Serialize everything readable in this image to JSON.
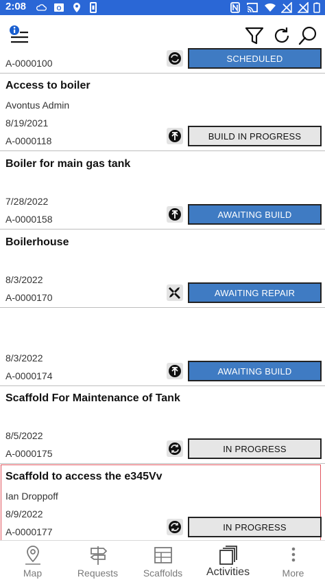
{
  "status_bar": {
    "time": "2:08",
    "icons": [
      "cloud-icon",
      "outlook-icon",
      "location-icon",
      "battery-saver-icon",
      "nfc-icon",
      "cast-icon",
      "wifi-icon",
      "no-signal-icon",
      "battery-icon"
    ]
  },
  "app_bar": {
    "icons": [
      "info-menu-icon",
      "filter-icon",
      "refresh-icon",
      "search-icon"
    ]
  },
  "partial_item": {
    "ref": "A-0000100",
    "status": "SCHEDULED"
  },
  "items": [
    {
      "title": "Access to boiler",
      "subtitle": "Avontus Admin",
      "date": "8/19/2021",
      "ref": "A-0000118",
      "status": "BUILD IN PROGRESS",
      "status_icon": "build-arrow-icon",
      "status_style": "gray"
    },
    {
      "title": "Boiler for main gas tank",
      "subtitle": "",
      "date": "7/28/2022",
      "ref": "A-0000158",
      "status": "AWAITING BUILD",
      "status_icon": "build-arrow-icon",
      "status_style": "blue"
    },
    {
      "title": "Boilerhouse",
      "subtitle": "",
      "date": "8/3/2022",
      "ref": "A-0000170",
      "status": "AWAITING REPAIR",
      "status_icon": "repair-tools-icon",
      "status_style": "blue"
    },
    {
      "title": "",
      "subtitle": "",
      "date": "8/3/2022",
      "ref": "A-0000174",
      "status": "AWAITING BUILD",
      "status_icon": "build-arrow-icon",
      "status_style": "blue"
    },
    {
      "title": "Scaffold For Maintenance of Tank",
      "subtitle": "",
      "date": "8/5/2022",
      "ref": "A-0000175",
      "status": "IN PROGRESS",
      "status_icon": "in-progress-cycle-icon",
      "status_style": "gray"
    },
    {
      "title": "Scaffold to access the e345Vv",
      "subtitle": "Ian Droppoff",
      "date": "8/9/2022",
      "ref": "A-0000177",
      "status": "IN PROGRESS",
      "status_icon": "in-progress-cycle-icon",
      "status_style": "gray",
      "selected": true
    }
  ],
  "bottom_nav": [
    {
      "label": "Map",
      "icon": "map-pin-icon"
    },
    {
      "label": "Requests",
      "icon": "signpost-icon"
    },
    {
      "label": "Scaffolds",
      "icon": "scaffold-grid-icon"
    },
    {
      "label": "Activities",
      "icon": "activities-stack-icon",
      "active": true
    },
    {
      "label": "More",
      "icon": "more-dots-icon"
    }
  ],
  "colors": {
    "status_bar": "#2a67d6",
    "button_blue": "#3f7bc3",
    "button_gray": "#e6e6e6",
    "selection_outline": "#e0535c"
  }
}
